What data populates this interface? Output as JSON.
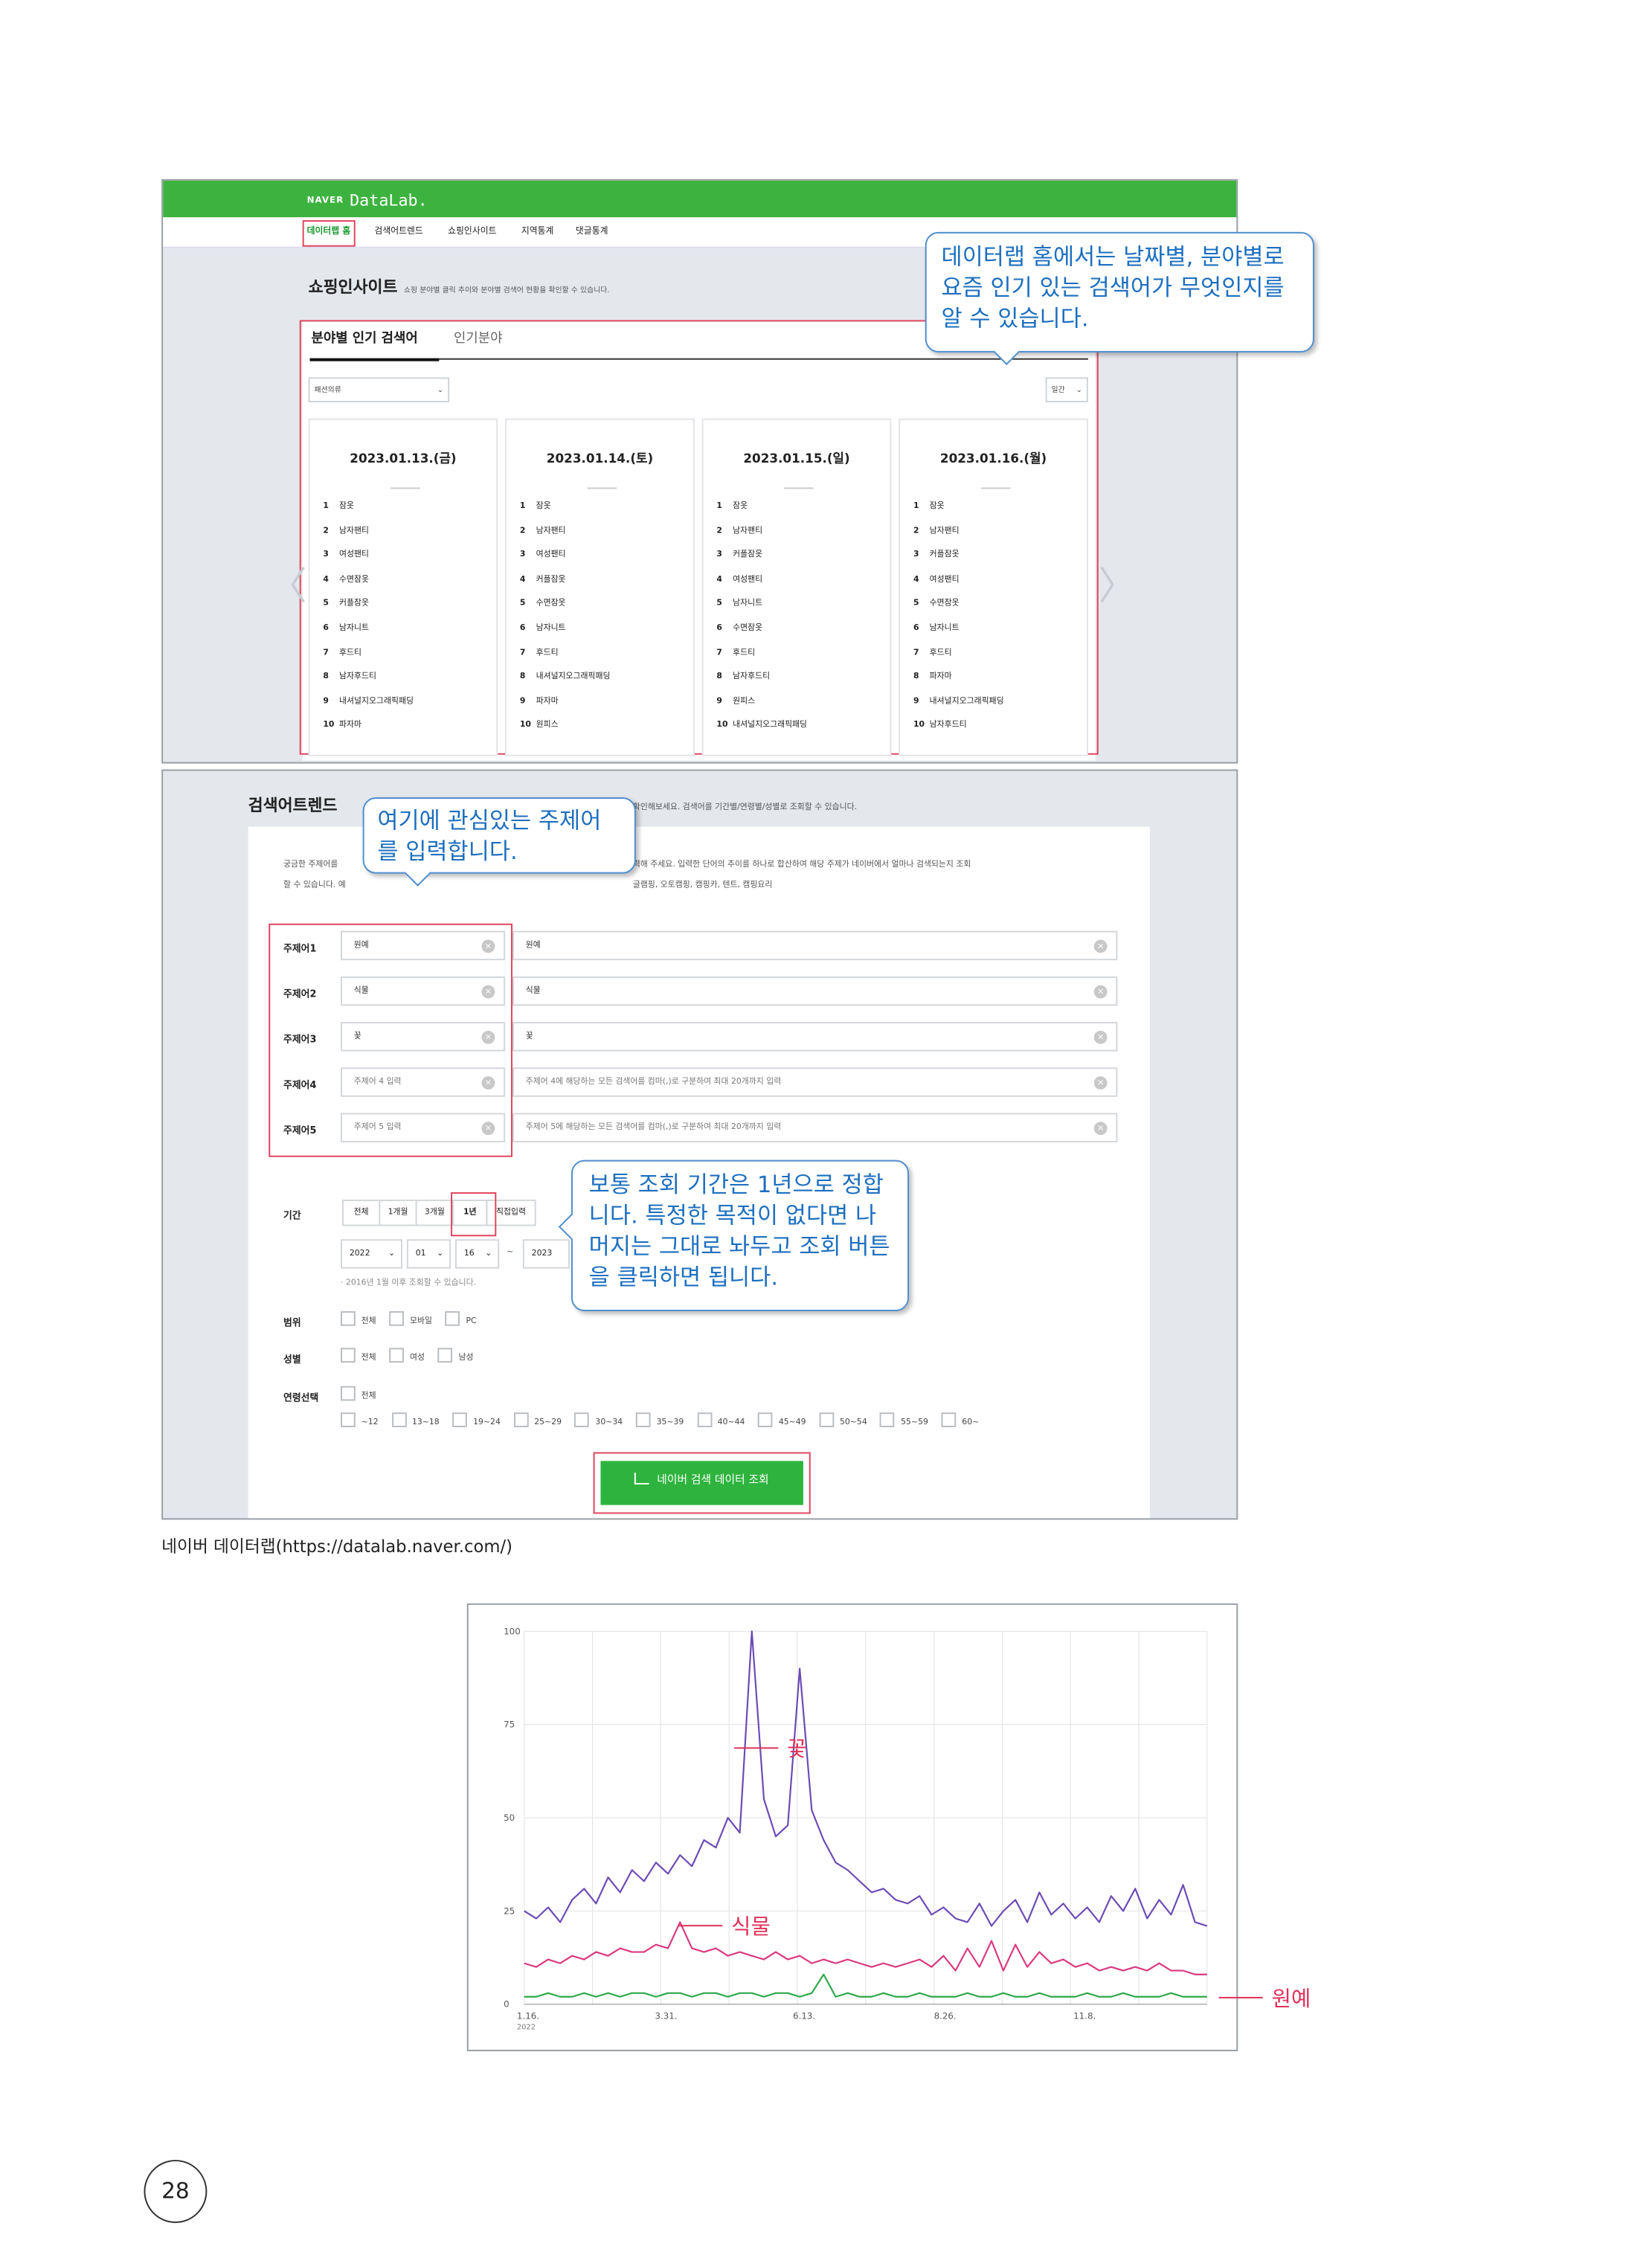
{
  "shot1": {
    "brand_naver": "NAVER",
    "brand_datalab": "DataLab.",
    "nav": [
      "데이터랩 홈",
      "검색어트렌드",
      "쇼핑인사이트",
      "지역통계",
      "댓글통계"
    ],
    "section_title": "쇼핑인사이트",
    "section_sub": "쇼핑 분야별 클릭 추이와 분야별 검색어 현황을 확인할 수 있습니다.",
    "tabs": [
      "분야별 인기 검색어",
      "인기분야"
    ],
    "category_select": "패션의류",
    "period_select": "일간",
    "cards": [
      {
        "date": "2023.01.13.(금)",
        "items": [
          "잠옷",
          "남자팬티",
          "여성팬티",
          "수면잠옷",
          "커플잠옷",
          "남자니트",
          "후드티",
          "남자후드티",
          "내셔널지오그래픽패딩",
          "파자마"
        ]
      },
      {
        "date": "2023.01.14.(토)",
        "items": [
          "잠옷",
          "남자팬티",
          "여성팬티",
          "커플잠옷",
          "수면잠옷",
          "남자니트",
          "후드티",
          "내셔널지오그래픽패딩",
          "파자마",
          "원피스"
        ]
      },
      {
        "date": "2023.01.15.(일)",
        "items": [
          "잠옷",
          "남자팬티",
          "커플잠옷",
          "여성팬티",
          "남자니트",
          "수면잠옷",
          "후드티",
          "남자후드티",
          "원피스",
          "내셔널지오그래픽패딩"
        ]
      },
      {
        "date": "2023.01.16.(월)",
        "items": [
          "잠옷",
          "남자팬티",
          "커플잠옷",
          "여성팬티",
          "수면잠옷",
          "남자니트",
          "후드티",
          "파자마",
          "내셔널지오그래픽패딩",
          "남자후드티"
        ]
      }
    ]
  },
  "callout1": "데이터랩 홈에서는 날짜별, 분야별로 요즘 인기 있는 검색어가 무엇인지를 알 수 있습니다.",
  "shot2": {
    "title": "검색어트렌드",
    "title_sub": "확인해보세요. 검색어를 기간별/연령별/성별로 조회할 수 있습니다.",
    "desc1": "궁금한 주제어를",
    "desc1b": "력해 주세요. 입력한 단어의 추이를 하나로 합산하여 해당 주제가 네이버에서 얼마나 검색되는지 조회",
    "desc2": "할 수 있습니다. 예",
    "desc2b": "글램핑, 오토캠핑, 캠핑카, 텐트, 캠핑요리",
    "topics": [
      {
        "label": "주제어1",
        "name": "원예",
        "terms": "원예",
        "name_ph": false,
        "terms_ph": false
      },
      {
        "label": "주제어2",
        "name": "식물",
        "terms": "식물",
        "name_ph": false,
        "terms_ph": false
      },
      {
        "label": "주제어3",
        "name": "꽃",
        "terms": "꽃",
        "name_ph": false,
        "terms_ph": false
      },
      {
        "label": "주제어4",
        "name": "주제어 4 입력",
        "terms": "주제어 4에 해당하는 모든 검색어를 컴마(,)로 구분하여 최대 20개까지 입력",
        "name_ph": true,
        "terms_ph": true
      },
      {
        "label": "주제어5",
        "name": "주제어 5 입력",
        "terms": "주제어 5에 해당하는 모든 검색어를 컴마(,)로 구분하여 최대 20개까지 입력",
        "name_ph": true,
        "terms_ph": true
      }
    ],
    "period_label": "기간",
    "period_options": [
      "전체",
      "1개월",
      "3개월",
      "1년",
      "직접입력"
    ],
    "period_selected": "1년",
    "date_from": {
      "year": "2022",
      "month": "01",
      "day": "16"
    },
    "date_to_year": "2023",
    "date_note": "· 2016년 1월 이후 조회할 수 있습니다.",
    "range_label": "범위",
    "range_options": [
      "전체",
      "모바일",
      "PC"
    ],
    "gender_label": "성별",
    "gender_options": [
      "전체",
      "여성",
      "남성"
    ],
    "age_label": "연령선택",
    "age_all": "전체",
    "age_options": [
      "~12",
      "13~18",
      "19~24",
      "25~29",
      "30~34",
      "35~39",
      "40~44",
      "45~49",
      "50~54",
      "55~59",
      "60~"
    ],
    "submit": "네이버 검색 데이터 조회"
  },
  "callout2": "여기에 관심있는 주제어를 입력합니다.",
  "callout3": "보통 조회 기간은 1년으로 정합니다. 특정한 목적이 없다면 나머지는 그대로 놔두고 조회 버튼을 클릭하면 됩니다.",
  "caption": "네이버 데이터랩(https://datalab.naver.com/)",
  "colors": {
    "naver_green": "#3db33f",
    "highlight_red": "#e0445e",
    "callout_blue": "#1d6fbf",
    "flower": "#6a4bb5",
    "plant": "#d9397e",
    "gardening": "#2ea84a"
  },
  "chart_data": {
    "type": "line",
    "x_ticks": [
      "1.16.",
      "3.31.",
      "6.13.",
      "8.26.",
      "11.8."
    ],
    "x_year": "2022",
    "y_ticks": [
      0,
      25,
      50,
      75,
      100
    ],
    "ylim": [
      0,
      100
    ],
    "grid": true,
    "series": [
      {
        "name": "꽃",
        "color": "#6a4bb5",
        "values": [
          25,
          23,
          26,
          22,
          28,
          31,
          27,
          34,
          30,
          36,
          33,
          38,
          35,
          40,
          37,
          44,
          42,
          50,
          46,
          100,
          55,
          45,
          48,
          90,
          52,
          44,
          38,
          36,
          33,
          30,
          31,
          28,
          27,
          29,
          24,
          26,
          23,
          22,
          27,
          21,
          25,
          28,
          22,
          30,
          24,
          27,
          23,
          26,
          22,
          29,
          25,
          31,
          23,
          28,
          24,
          32,
          22,
          21
        ]
      },
      {
        "name": "식물",
        "color": "#d9397e",
        "values": [
          11,
          10,
          12,
          11,
          13,
          12,
          14,
          13,
          15,
          14,
          14,
          16,
          15,
          22,
          15,
          14,
          15,
          13,
          14,
          13,
          12,
          14,
          12,
          13,
          11,
          12,
          11,
          12,
          11,
          10,
          11,
          10,
          11,
          12,
          10,
          13,
          9,
          15,
          10,
          17,
          9,
          16,
          10,
          14,
          11,
          12,
          10,
          11,
          9,
          10,
          9,
          10,
          9,
          11,
          9,
          9,
          8,
          8
        ]
      },
      {
        "name": "원예",
        "color": "#2ea84a",
        "values": [
          2,
          2,
          3,
          2,
          2,
          3,
          2,
          3,
          2,
          3,
          3,
          2,
          3,
          3,
          2,
          3,
          3,
          2,
          3,
          3,
          2,
          3,
          3,
          2,
          3,
          8,
          2,
          3,
          2,
          2,
          3,
          2,
          2,
          3,
          2,
          2,
          2,
          3,
          2,
          2,
          3,
          2,
          2,
          3,
          2,
          2,
          2,
          3,
          2,
          2,
          3,
          2,
          2,
          2,
          3,
          2,
          2,
          2
        ]
      }
    ]
  },
  "page_number": "28"
}
